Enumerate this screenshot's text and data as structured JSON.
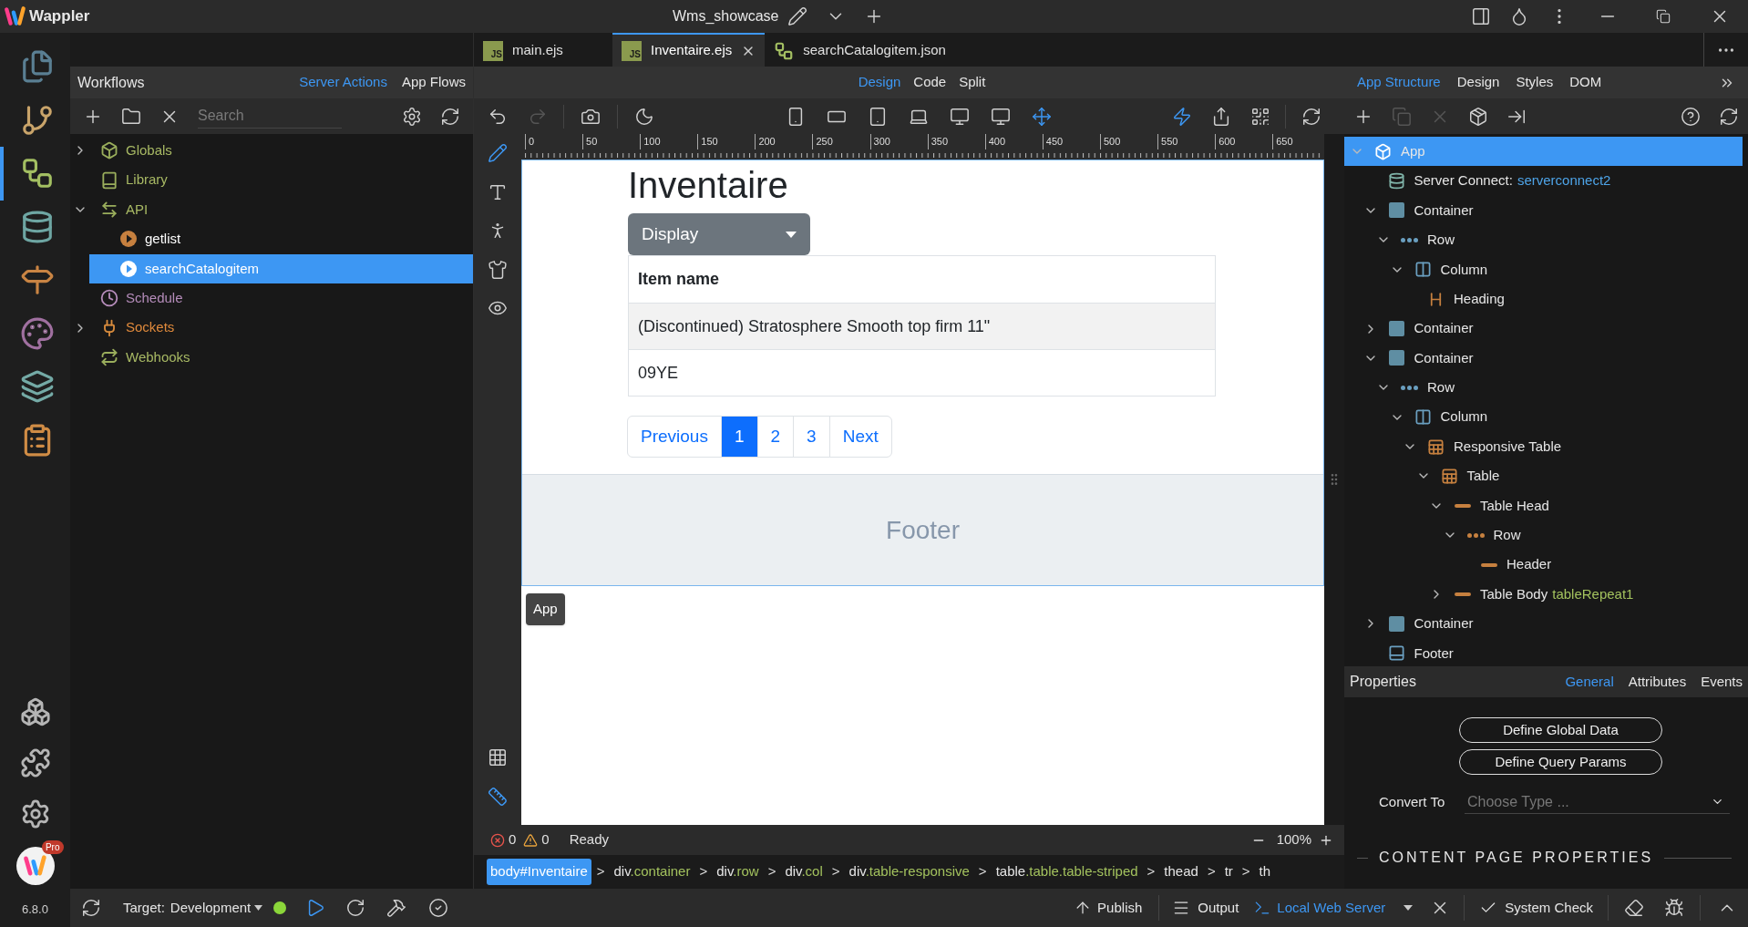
{
  "app": {
    "name": "Wappler",
    "project": "Wms_showcase",
    "version": "6.8.0",
    "plan_badge": "Pro"
  },
  "rail": [
    {
      "kind": "files",
      "selected": false
    },
    {
      "kind": "git",
      "selected": false
    },
    {
      "kind": "workflows",
      "selected": true
    },
    {
      "kind": "database",
      "selected": false
    },
    {
      "kind": "routing",
      "selected": false
    },
    {
      "kind": "design",
      "selected": false
    },
    {
      "kind": "layers",
      "selected": false
    },
    {
      "kind": "tasks",
      "selected": false
    }
  ],
  "rail_bottom": [
    {
      "kind": "extensions"
    },
    {
      "kind": "plugins"
    },
    {
      "kind": "settings"
    }
  ],
  "workflows": {
    "title": "Workflows",
    "tabs": [
      {
        "label": "Server Actions",
        "selected": true
      },
      {
        "label": "App Flows",
        "selected": false
      }
    ],
    "search": {
      "placeholder": "Search"
    },
    "tree": [
      {
        "label": "Globals",
        "kind": "globals",
        "color": "#a8b964",
        "selected": false,
        "expanded": false
      },
      {
        "label": "Library",
        "kind": "library",
        "color": "#a8b964",
        "selected": false
      },
      {
        "label": "API",
        "kind": "api",
        "color": "#a8b964",
        "selected": false,
        "expanded": true,
        "children": [
          {
            "label": "getlist",
            "kind": "action",
            "selected": false
          },
          {
            "label": "searchCatalogitem",
            "kind": "action",
            "selected": true
          }
        ]
      },
      {
        "label": "Schedule",
        "kind": "schedule",
        "color": "#b58cba",
        "selected": false
      },
      {
        "label": "Sockets",
        "kind": "sockets",
        "color": "#e08a3c",
        "selected": false,
        "expanded": false
      },
      {
        "label": "Webhooks",
        "kind": "webhooks",
        "color": "#a8b964",
        "selected": false
      }
    ]
  },
  "editor": {
    "tabs": [
      {
        "label": "main.ejs",
        "kind": "ejs",
        "icon_text": "JS",
        "selected": false
      },
      {
        "label": "Inventaire.ejs",
        "kind": "ejs",
        "icon_text": "JS",
        "selected": true
      },
      {
        "label": "searchCatalogitem.json",
        "kind": "flow",
        "selected": false
      }
    ],
    "modes": [
      {
        "label": "Design",
        "selected": true
      },
      {
        "label": "Code",
        "selected": false
      },
      {
        "label": "Split",
        "selected": false
      }
    ],
    "history": [
      {
        "kind": "undo",
        "disabled": false
      },
      {
        "kind": "redo",
        "disabled": true
      }
    ],
    "devices": [
      {
        "kind": "phone",
        "selected": false
      },
      {
        "kind": "tablet-landscape",
        "selected": false
      },
      {
        "kind": "tablet",
        "selected": false
      },
      {
        "kind": "laptop",
        "selected": false
      },
      {
        "kind": "desktop",
        "selected": false
      },
      {
        "kind": "wide",
        "selected": false
      },
      {
        "kind": "fit",
        "selected": true
      }
    ],
    "actions": [
      {
        "kind": "live",
        "on": true
      },
      {
        "kind": "share",
        "on": false
      },
      {
        "kind": "qr",
        "on": false
      }
    ],
    "tools": [
      {
        "kind": "edit",
        "selected": true
      },
      {
        "kind": "text",
        "selected": false
      },
      {
        "kind": "figure",
        "selected": false
      },
      {
        "kind": "theme",
        "selected": false
      },
      {
        "kind": "preview",
        "selected": false
      }
    ],
    "tools_bottom": [
      {
        "kind": "grid",
        "selected": false
      },
      {
        "kind": "ruler",
        "selected": true
      }
    ],
    "ruler": [
      "0",
      "50",
      "100",
      "150",
      "200",
      "250",
      "300",
      "350",
      "400",
      "450",
      "500",
      "550",
      "600",
      "650"
    ],
    "page": {
      "heading": "Inventaire",
      "dropdown": "Display",
      "table": {
        "columns": [
          "Item name"
        ],
        "rows": [
          [
            "(Discontinued) Stratosphere Smooth top firm 11\""
          ],
          [
            "09YE"
          ]
        ]
      },
      "pagination": [
        {
          "label": "Previous",
          "selected": false
        },
        {
          "label": "1",
          "selected": true
        },
        {
          "label": "2",
          "selected": false
        },
        {
          "label": "3",
          "selected": false
        },
        {
          "label": "Next",
          "selected": false
        }
      ],
      "footer": "Footer",
      "selection_label": "App"
    },
    "status": {
      "errors": "0",
      "warnings": "0",
      "state": "Ready",
      "zoom": "100%"
    },
    "separator": ">",
    "breadcrumb": [
      {
        "tag": "body#Inventaire",
        "selected": true
      },
      {
        "tag": "div",
        "cls": ".container",
        "selected": false
      },
      {
        "tag": "div",
        "cls": ".row",
        "selected": false
      },
      {
        "tag": "div",
        "cls": ".col",
        "selected": false
      },
      {
        "tag": "div",
        "cls": ".table-responsive",
        "selected": false
      },
      {
        "tag": "table",
        "cls": ".table.table-striped",
        "selected": false
      },
      {
        "tag": "thead",
        "selected": false
      },
      {
        "tag": "tr",
        "selected": false
      },
      {
        "tag": "th",
        "selected": false
      }
    ]
  },
  "structure": {
    "tabs": [
      {
        "label": "App Structure",
        "selected": true
      },
      {
        "label": "Design",
        "selected": false
      },
      {
        "label": "Styles",
        "selected": false
      },
      {
        "label": "DOM",
        "selected": false
      }
    ],
    "toolbar_left": [
      {
        "kind": "add",
        "disabled": false
      },
      {
        "kind": "duplicate",
        "disabled": true
      },
      {
        "kind": "delete",
        "disabled": true
      },
      {
        "kind": "wrap",
        "disabled": false
      },
      {
        "kind": "move",
        "disabled": false
      }
    ],
    "toolbar_right": [
      {
        "kind": "help",
        "disabled": false
      },
      {
        "kind": "refresh",
        "disabled": false
      }
    ],
    "tree": [
      {
        "label": "App",
        "kind": "app",
        "selected": true,
        "expanded": true,
        "children": [
          {
            "label": "Server Connect:",
            "kind": "server-connect",
            "selected": false,
            "suffix": {
              "text": "serverconnect2",
              "color": "#4ea4e8"
            }
          },
          {
            "label": "Container",
            "kind": "container",
            "selected": false,
            "expanded": true,
            "children": [
              {
                "label": "Row",
                "kind": "row",
                "selected": false,
                "expanded": true,
                "children": [
                  {
                    "label": "Column",
                    "kind": "column",
                    "selected": false,
                    "expanded": true,
                    "children": [
                      {
                        "label": "Heading",
                        "kind": "heading",
                        "selected": false
                      }
                    ]
                  }
                ]
              }
            ]
          },
          {
            "label": "Container",
            "kind": "container",
            "selected": false,
            "expanded": false
          },
          {
            "label": "Container",
            "kind": "container",
            "selected": false,
            "expanded": true,
            "children": [
              {
                "label": "Row",
                "kind": "row",
                "selected": false,
                "expanded": true,
                "children": [
                  {
                    "label": "Column",
                    "kind": "column",
                    "selected": false,
                    "expanded": true,
                    "children": [
                      {
                        "label": "Responsive Table",
                        "kind": "table",
                        "selected": false,
                        "expanded": true,
                        "children": [
                          {
                            "label": "Table",
                            "kind": "table",
                            "selected": false,
                            "expanded": true,
                            "children": [
                              {
                                "label": "Table Head",
                                "kind": "table-part",
                                "selected": false,
                                "expanded": true,
                                "children": [
                                  {
                                    "label": "Row",
                                    "kind": "table-row",
                                    "selected": false,
                                    "expanded": true,
                                    "children": [
                                      {
                                        "label": "Header",
                                        "kind": "table-part",
                                        "selected": false
                                      }
                                    ]
                                  }
                                ]
                              },
                              {
                                "label": "Table Body",
                                "kind": "table-part",
                                "selected": false,
                                "expanded": false,
                                "suffix": {
                                  "text": "tableRepeat1",
                                  "color": "#a3c25e"
                                }
                              }
                            ]
                          }
                        ]
                      }
                    ]
                  }
                ]
              }
            ]
          },
          {
            "label": "Container",
            "kind": "container",
            "selected": false,
            "expanded": false
          },
          {
            "label": "Footer",
            "kind": "footer",
            "selected": false
          }
        ]
      }
    ]
  },
  "properties": {
    "title": "Properties",
    "tabs": [
      {
        "label": "General",
        "selected": true
      },
      {
        "label": "Attributes",
        "selected": false
      },
      {
        "label": "Events",
        "selected": false
      }
    ],
    "buttons": [
      "Define Global Data",
      "Define Query Params"
    ],
    "convert_to": {
      "label": "Convert To",
      "placeholder": "Choose Type ..."
    },
    "section": "CONTENT PAGE PROPERTIES"
  },
  "bottom_bar": {
    "target_label": "Target:",
    "target": "Development",
    "server_running": true,
    "publish": "Publish",
    "output": "Output",
    "server": "Local Web Server",
    "system_check": "System Check"
  }
}
